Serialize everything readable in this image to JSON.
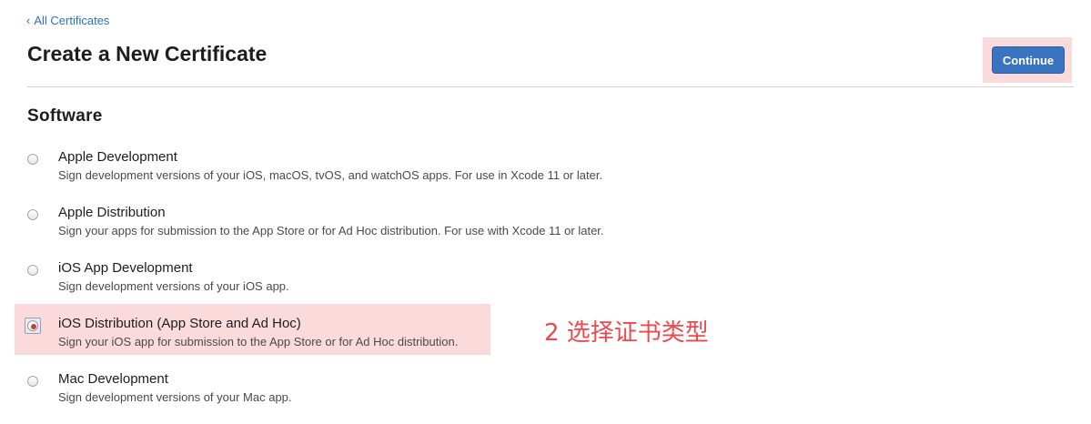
{
  "nav": {
    "back_chevron": "‹",
    "back_label": "All Certificates"
  },
  "header": {
    "title": "Create a New Certificate",
    "continue_label": "Continue"
  },
  "section": {
    "title": "Software"
  },
  "options": [
    {
      "label": "Apple Development",
      "description": "Sign development versions of your iOS, macOS, tvOS, and watchOS apps. For use in Xcode 11 or later.",
      "selected": false
    },
    {
      "label": "Apple Distribution",
      "description": "Sign your apps for submission to the App Store or for Ad Hoc distribution. For use with Xcode 11 or later.",
      "selected": false
    },
    {
      "label": "iOS App Development",
      "description": "Sign development versions of your iOS app.",
      "selected": false
    },
    {
      "label": "iOS Distribution (App Store and Ad Hoc)",
      "description": "Sign your iOS app for submission to the App Store or for Ad Hoc distribution.",
      "selected": true
    },
    {
      "label": "Mac Development",
      "description": "Sign development versions of your Mac app.",
      "selected": false
    }
  ],
  "annotation": {
    "text": "2 选择证书类型"
  },
  "colors": {
    "link": "#2a72c4",
    "button": "#3a74c0",
    "highlight": "#fadadb",
    "annotation": "#f0484d"
  }
}
